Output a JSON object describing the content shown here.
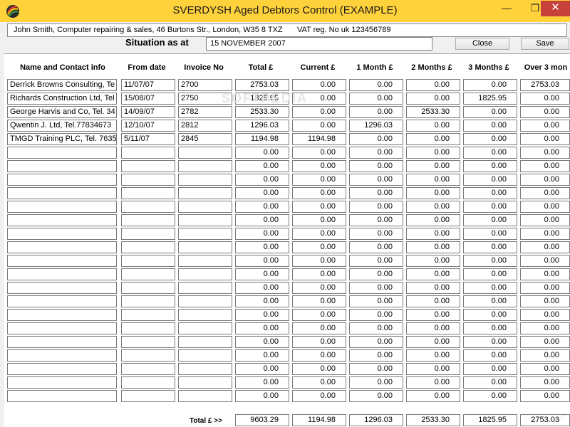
{
  "window": {
    "title": "SVERDYSH Aged Debtors Control (EXAMPLE)",
    "min_glyph": "—",
    "max_glyph": "❐",
    "close_glyph": "✕"
  },
  "company": {
    "address": "John Smith, Computer repairing & sales, 46 Burtons Str., London, W35 8 TXZ",
    "vat": "VAT reg. No uk 123456789"
  },
  "situation": {
    "label": "Situation as at",
    "date": "15 NOVEMBER 2007"
  },
  "buttons": {
    "close": "Close",
    "save": "Save"
  },
  "watermark": "SOFTPEDIA",
  "columns": [
    "Name and Contact info",
    "From date",
    "Invoice No",
    "Total £",
    "Current £",
    "1 Month £",
    "2 Months £",
    "3 Months £",
    "Over 3 mon"
  ],
  "rows": [
    [
      "Derrick Browns Consulting, Te",
      "11/07/07",
      "2700",
      "2753.03",
      "0.00",
      "0.00",
      "0.00",
      "0.00",
      "2753.03"
    ],
    [
      "Richards Construction Ltd, Tel",
      "15/08/07",
      "2750",
      "1825.95",
      "0.00",
      "0.00",
      "0.00",
      "1825.95",
      "0.00"
    ],
    [
      "George Harvis and Co, Tel. 34",
      "14/09/07",
      "2782",
      "2533.30",
      "0.00",
      "0.00",
      "2533.30",
      "0.00",
      "0.00"
    ],
    [
      "Qwentin J. Ltd,  Tel.77834673",
      "12/10/07",
      "2812",
      "1296.03",
      "0.00",
      "1296.03",
      "0.00",
      "0.00",
      "0.00"
    ],
    [
      "TMGD Training PLC,  Tel. 7635",
      "5/11/07",
      "2845",
      "1194.98",
      "1194.98",
      "0.00",
      "0.00",
      "0.00",
      "0.00"
    ],
    [
      "",
      "",
      "",
      "0.00",
      "0.00",
      "0.00",
      "0.00",
      "0.00",
      "0.00"
    ],
    [
      "",
      "",
      "",
      "0.00",
      "0.00",
      "0.00",
      "0.00",
      "0.00",
      "0.00"
    ],
    [
      "",
      "",
      "",
      "0.00",
      "0.00",
      "0.00",
      "0.00",
      "0.00",
      "0.00"
    ],
    [
      "",
      "",
      "",
      "0.00",
      "0.00",
      "0.00",
      "0.00",
      "0.00",
      "0.00"
    ],
    [
      "",
      "",
      "",
      "0.00",
      "0.00",
      "0.00",
      "0.00",
      "0.00",
      "0.00"
    ],
    [
      "",
      "",
      "",
      "0.00",
      "0.00",
      "0.00",
      "0.00",
      "0.00",
      "0.00"
    ],
    [
      "",
      "",
      "",
      "0.00",
      "0.00",
      "0.00",
      "0.00",
      "0.00",
      "0.00"
    ],
    [
      "",
      "",
      "",
      "0.00",
      "0.00",
      "0.00",
      "0.00",
      "0.00",
      "0.00"
    ],
    [
      "",
      "",
      "",
      "0.00",
      "0.00",
      "0.00",
      "0.00",
      "0.00",
      "0.00"
    ],
    [
      "",
      "",
      "",
      "0.00",
      "0.00",
      "0.00",
      "0.00",
      "0.00",
      "0.00"
    ],
    [
      "",
      "",
      "",
      "0.00",
      "0.00",
      "0.00",
      "0.00",
      "0.00",
      "0.00"
    ],
    [
      "",
      "",
      "",
      "0.00",
      "0.00",
      "0.00",
      "0.00",
      "0.00",
      "0.00"
    ],
    [
      "",
      "",
      "",
      "0.00",
      "0.00",
      "0.00",
      "0.00",
      "0.00",
      "0.00"
    ],
    [
      "",
      "",
      "",
      "0.00",
      "0.00",
      "0.00",
      "0.00",
      "0.00",
      "0.00"
    ],
    [
      "",
      "",
      "",
      "0.00",
      "0.00",
      "0.00",
      "0.00",
      "0.00",
      "0.00"
    ],
    [
      "",
      "",
      "",
      "0.00",
      "0.00",
      "0.00",
      "0.00",
      "0.00",
      "0.00"
    ],
    [
      "",
      "",
      "",
      "0.00",
      "0.00",
      "0.00",
      "0.00",
      "0.00",
      "0.00"
    ],
    [
      "",
      "",
      "",
      "0.00",
      "0.00",
      "0.00",
      "0.00",
      "0.00",
      "0.00"
    ],
    [
      "",
      "",
      "",
      "0.00",
      "0.00",
      "0.00",
      "0.00",
      "0.00",
      "0.00"
    ]
  ],
  "totals": {
    "label": "Total £ >>",
    "values": [
      "9603.29",
      "1194.98",
      "1296.03",
      "2533.30",
      "1825.95",
      "2753.03"
    ]
  },
  "colors": {
    "titlebar": "#ffd23c",
    "close_button": "#c7413b"
  }
}
